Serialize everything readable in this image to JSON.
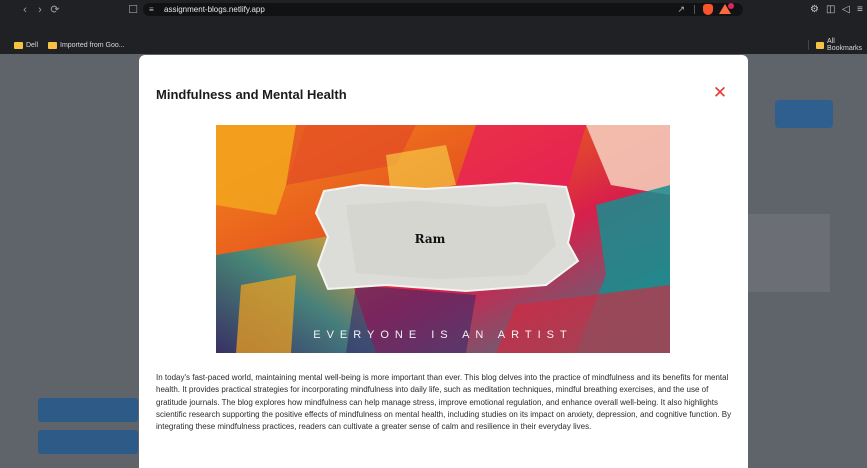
{
  "browser": {
    "url": "assignment-blogs.netlify.app",
    "nav": {
      "back_icon": "back-arrow-icon",
      "forward_icon": "forward-arrow-icon",
      "reload_icon": "reload-icon",
      "bookmark_icon": "bookmark-icon"
    },
    "bookmarks": [
      {
        "label": "Dell"
      },
      {
        "label": "Imported from Goo..."
      }
    ],
    "all_bookmarks_label": "All Bookmarks"
  },
  "modal": {
    "title": "Mindfulness and Mental Health",
    "close_symbol": "✕",
    "image": {
      "overlay_text": "Ram",
      "caption": "EVERYONE IS AN ARTIST"
    },
    "body": "In today's fast-paced world, maintaining mental well-being is more important than ever. This blog delves into the practice of mindfulness and its benefits for mental health. It provides practical strategies for incorporating mindfulness into daily life, such as meditation techniques, mindful breathing exercises, and the use of gratitude journals. The blog explores how mindfulness can help manage stress, improve emotional regulation, and enhance overall well-being. It also highlights scientific research supporting the positive effects of mindfulness on mental health, including studies on its impact on anxiety, depression, and cognitive function. By integrating these mindfulness practices, readers can cultivate a greater sense of calm and resilience in their everyday lives."
  },
  "colors": {
    "close": "#e53935",
    "overlay": "#5f636a",
    "chrome": "#202124"
  }
}
